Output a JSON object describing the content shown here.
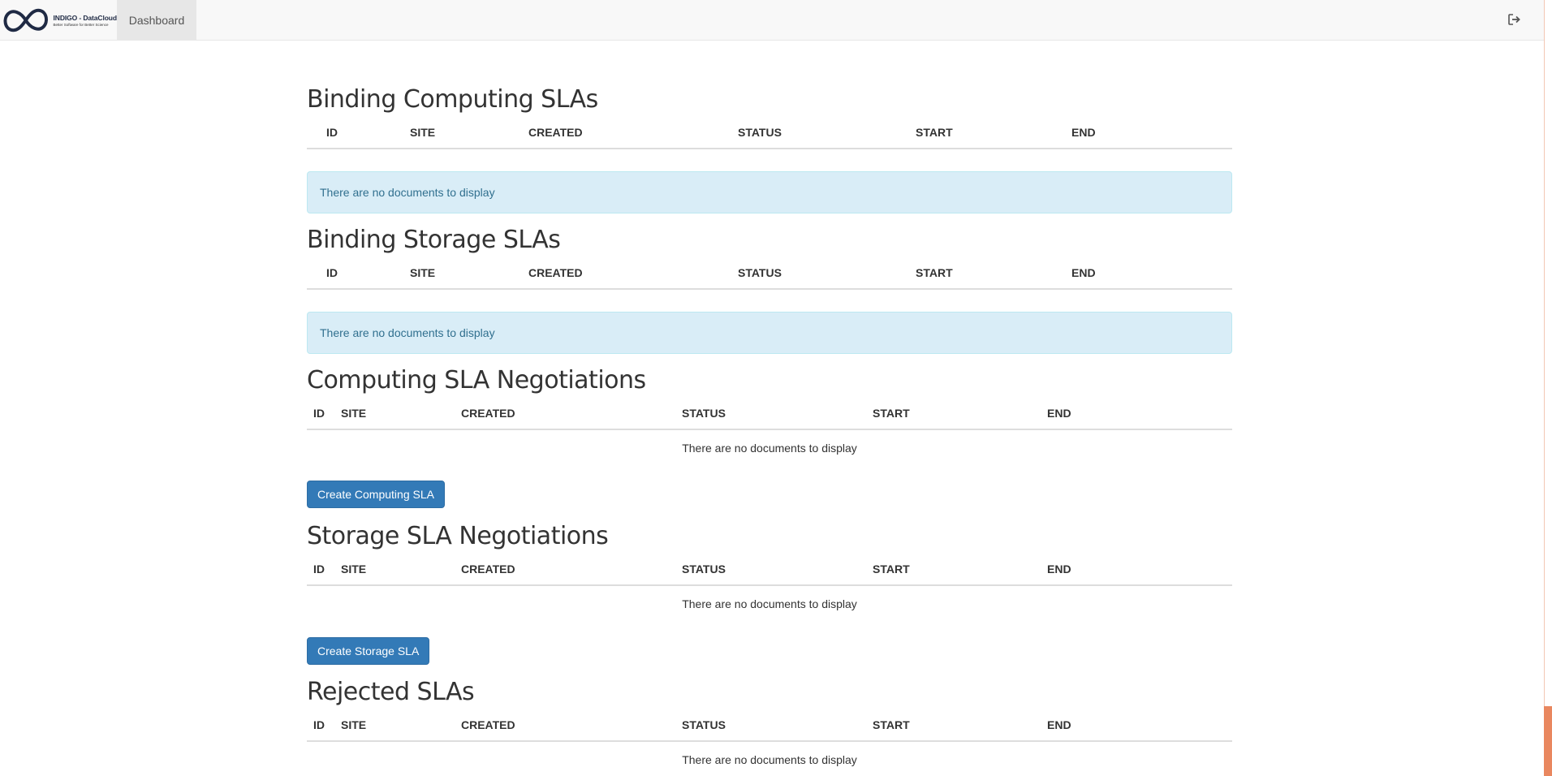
{
  "navbar": {
    "brand_name": "INDIGO - DataCloud",
    "brand_tagline": "Better Software for Better Science",
    "dashboard_label": "Dashboard",
    "logout_icon": "sign-out-icon"
  },
  "sections": {
    "binding_computing": {
      "title": "Binding Computing SLAs",
      "columns": [
        "ID",
        "SITE",
        "CREATED",
        "STATUS",
        "START",
        "END"
      ],
      "empty_message": "There are no documents to display"
    },
    "binding_storage": {
      "title": "Binding Storage SLAs",
      "columns": [
        "ID",
        "SITE",
        "CREATED",
        "STATUS",
        "START",
        "END"
      ],
      "empty_message": "There are no documents to display"
    },
    "computing_negotiations": {
      "title": "Computing SLA Negotiations",
      "columns": [
        "ID",
        "SITE",
        "CREATED",
        "STATUS",
        "START",
        "END"
      ],
      "empty_message": "There are no documents to display",
      "button_label": "Create Computing SLA"
    },
    "storage_negotiations": {
      "title": "Storage SLA Negotiations",
      "columns": [
        "ID",
        "SITE",
        "CREATED",
        "STATUS",
        "START",
        "END"
      ],
      "empty_message": "There are no documents to display",
      "button_label": "Create Storage SLA"
    },
    "rejected": {
      "title": "Rejected SLAs",
      "columns": [
        "ID",
        "SITE",
        "CREATED",
        "STATUS",
        "START",
        "END"
      ],
      "empty_message": "There are no documents to display"
    }
  },
  "colors": {
    "navbar_bg": "#f8f8f8",
    "alert_bg": "#d9edf7",
    "alert_text": "#31708f",
    "primary_button": "#337ab7",
    "scrollbar_accent": "#e9875f"
  }
}
